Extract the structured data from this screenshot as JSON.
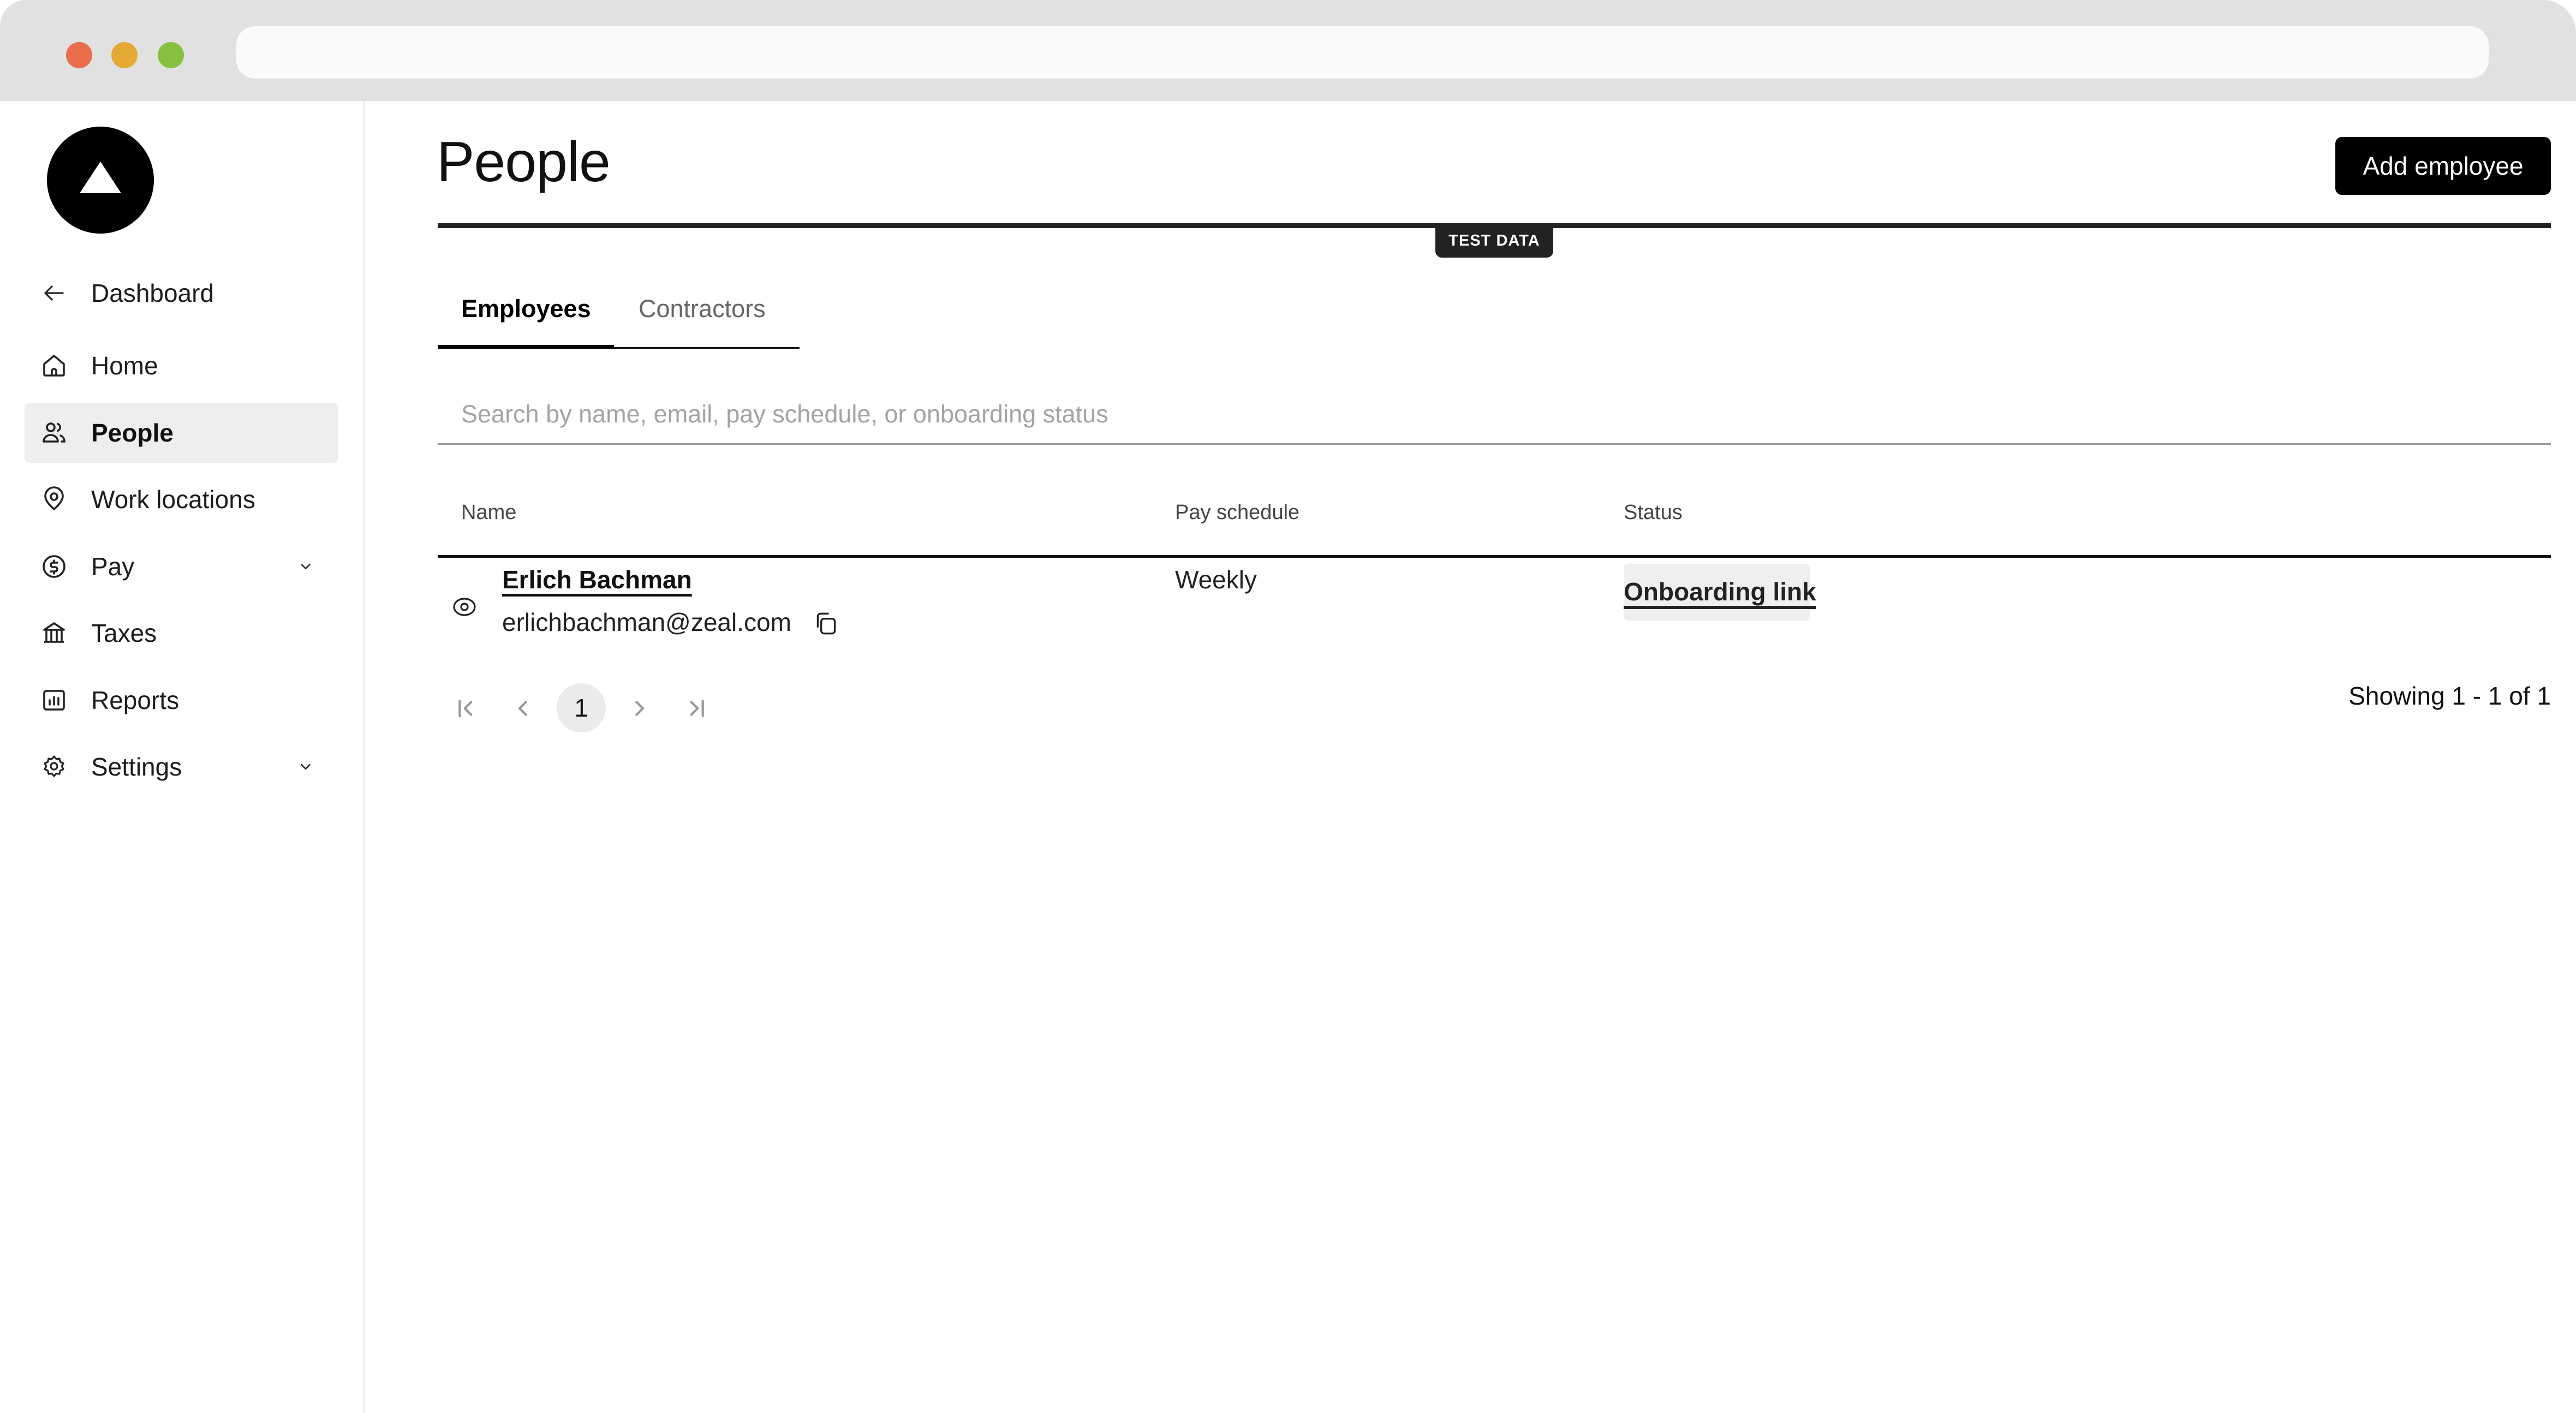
{
  "browser": {
    "traffic_lights": [
      {
        "name": "close",
        "color": "#e96d4c"
      },
      {
        "name": "minimize",
        "color": "#e4a935"
      },
      {
        "name": "maximize",
        "color": "#86c03c"
      }
    ],
    "url": ""
  },
  "sidebar": {
    "logo_icon": "triangle-logo",
    "items": [
      {
        "label": "Dashboard",
        "icon": "arrow-left-icon",
        "active": false,
        "expandable": false
      },
      {
        "label": "Home",
        "icon": "home-icon",
        "active": false,
        "expandable": false
      },
      {
        "label": "People",
        "icon": "people-icon",
        "active": true,
        "expandable": false
      },
      {
        "label": "Work locations",
        "icon": "location-pin-icon",
        "active": false,
        "expandable": false
      },
      {
        "label": "Pay",
        "icon": "dollar-circle-icon",
        "active": false,
        "expandable": true
      },
      {
        "label": "Taxes",
        "icon": "bank-icon",
        "active": false,
        "expandable": false
      },
      {
        "label": "Reports",
        "icon": "chart-box-icon",
        "active": false,
        "expandable": false
      },
      {
        "label": "Settings",
        "icon": "gear-icon",
        "active": false,
        "expandable": true
      }
    ]
  },
  "header": {
    "title": "People",
    "add_button_label": "Add employee",
    "badge": "TEST DATA"
  },
  "tabs": [
    {
      "label": "Employees",
      "active": true
    },
    {
      "label": "Contractors",
      "active": false
    }
  ],
  "search": {
    "placeholder": "Search by name, email, pay schedule, or onboarding status",
    "value": ""
  },
  "table": {
    "columns": [
      "Name",
      "Pay schedule",
      "Status"
    ],
    "rows": [
      {
        "name": "Erlich Bachman",
        "email": "erlichbachman@zeal.com",
        "pay_schedule": "Weekly",
        "status": "Onboarding link"
      }
    ]
  },
  "pagination": {
    "current_page": "1",
    "summary": "Showing 1 - 1 of 1"
  },
  "colors": {
    "accent": "#000000",
    "active_nav_bg": "#eeeeee",
    "badge_bg": "#222222"
  }
}
